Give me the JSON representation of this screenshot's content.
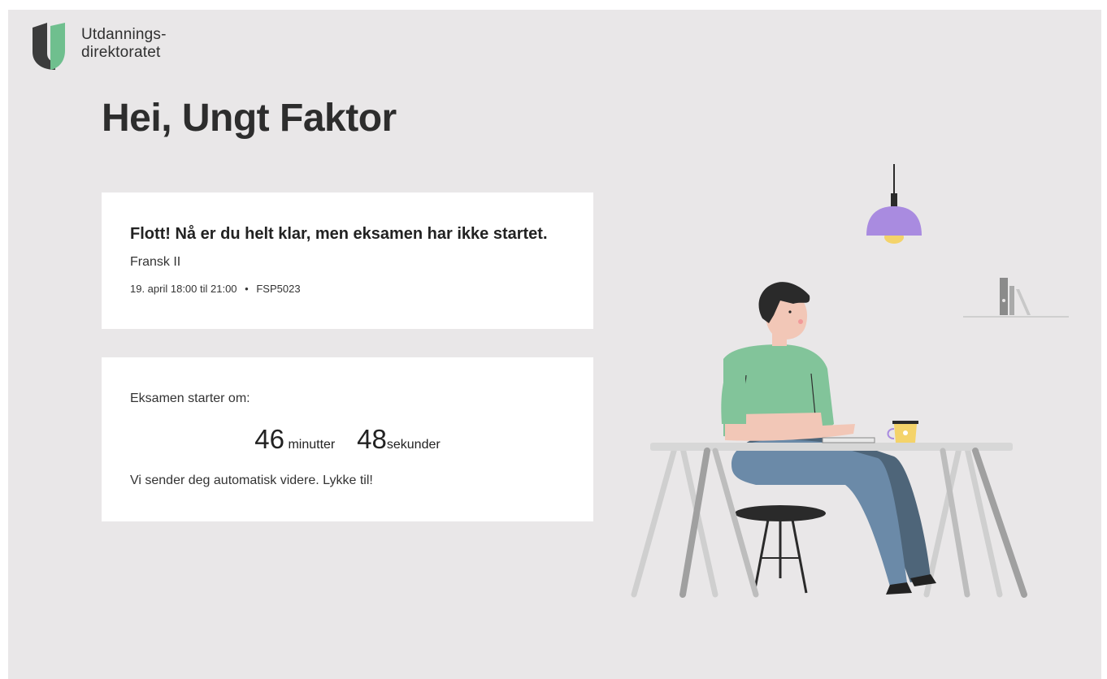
{
  "brand": {
    "logo_line1": "Utdannings-",
    "logo_line2": "direktoratet",
    "logo_icon": "udir-logo-icon",
    "colors": {
      "dark": "#3c3c3c",
      "green": "#6fbf8e"
    }
  },
  "greeting": "Hei, Ungt Faktor",
  "status_card": {
    "title": "Flott! Nå er du helt klar, men eksamen har ikke startet.",
    "subject": "Fransk II",
    "time": "19. april 18:00 til 21:00",
    "separator": "•",
    "code": "FSP5023"
  },
  "countdown_card": {
    "label": "Eksamen starter om:",
    "minutes_value": "46",
    "minutes_unit": "minutter",
    "seconds_value": "48",
    "seconds_unit": "sekunder",
    "note": "Vi sender deg automatisk videre. Lykke til!"
  },
  "colors": {
    "background": "#e9e7e8",
    "card": "#ffffff",
    "lamp": "#a98be0",
    "shirt": "#82c49a",
    "trousers": "#6b8aa8"
  }
}
